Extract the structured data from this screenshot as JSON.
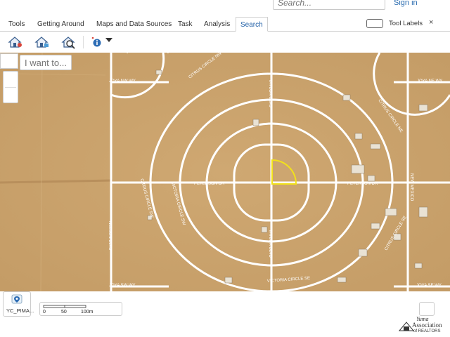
{
  "header": {
    "search_placeholder": "Search...",
    "sign_in": "Sign in"
  },
  "ribbon": {
    "tabs": [
      {
        "label": "Tools"
      },
      {
        "label": "Getting Around"
      },
      {
        "label": "Maps and Data Sources"
      },
      {
        "label": "Task"
      },
      {
        "label": "Analysis"
      },
      {
        "label": "Search",
        "active": true
      }
    ],
    "tool_labels": "Tool Labels",
    "close": "×"
  },
  "toolbar": {
    "icons": [
      "home-search-icon",
      "home-locate-icon",
      "home-magnify-icon",
      "info-icon",
      "chevron-down-icon"
    ]
  },
  "map": {
    "i_want_to": "I want to...",
    "roads": {
      "joya_nw": "JOYA NW WY",
      "joya_ne": "JOYA NE WY",
      "joya_sw": "JOYA SW WY",
      "joya_se": "JOYA SE WY",
      "citrus_nw": "CITRUS CIRCLE NW",
      "citrus_ne": "CITRUS CIRCLE NE",
      "citrus_sw": "CITRUS CIRCLE SW",
      "citrus_se": "CITRUS CIRCLE SE",
      "taylor_n": "TAYLOR BLVD",
      "taylor_s": "TAYLOR BLVD",
      "peterson_w": "PETERSON DR",
      "peterson_e": "PETERSON DR",
      "victoria_sw": "VICTORIA CIRCLE SW",
      "victoria_se": "VICTORIA CIRCLE SE",
      "nelson": "NELSON BLVD",
      "new_mexico": "NEW MEXICO"
    },
    "colors": {
      "terrain": "#c9a36d",
      "road": "#ffffff",
      "parcel": "#f2e21a"
    }
  },
  "bottom": {
    "layer_label": "YC_PIMA...",
    "scale": {
      "labels": [
        "0",
        "50",
        "100m"
      ]
    },
    "logo": {
      "line1": "Yuma",
      "line2": "Association",
      "line3": "of REALTORS"
    }
  }
}
